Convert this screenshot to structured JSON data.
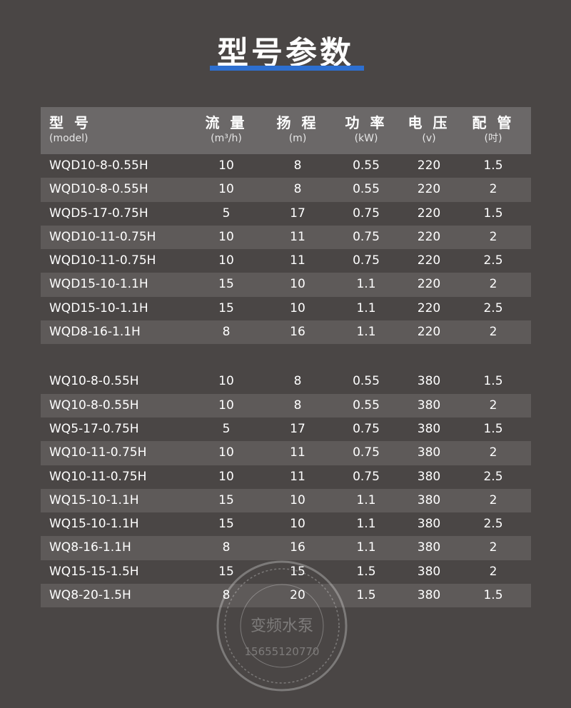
{
  "title": "型号参数",
  "headers": [
    {
      "zh": "型 号",
      "en": "(model)"
    },
    {
      "zh": "流 量",
      "en": "(m³/h)"
    },
    {
      "zh": "扬 程",
      "en": "(m)"
    },
    {
      "zh": "功 率",
      "en": "(kW)"
    },
    {
      "zh": "电 压",
      "en": "(v)"
    },
    {
      "zh": "配 管",
      "en": "(吋)"
    }
  ],
  "group1": [
    [
      "WQD10-8-0.55H",
      "10",
      "8",
      "0.55",
      "220",
      "1.5"
    ],
    [
      "WQD10-8-0.55H",
      "10",
      "8",
      "0.55",
      "220",
      "2"
    ],
    [
      "WQD5-17-0.75H",
      "5",
      "17",
      "0.75",
      "220",
      "1.5"
    ],
    [
      "WQD10-11-0.75H",
      "10",
      "11",
      "0.75",
      "220",
      "2"
    ],
    [
      "WQD10-11-0.75H",
      "10",
      "11",
      "0.75",
      "220",
      "2.5"
    ],
    [
      "WQD15-10-1.1H",
      "15",
      "10",
      "1.1",
      "220",
      "2"
    ],
    [
      "WQD15-10-1.1H",
      "15",
      "10",
      "1.1",
      "220",
      "2.5"
    ],
    [
      "WQD8-16-1.1H",
      "8",
      "16",
      "1.1",
      "220",
      "2"
    ]
  ],
  "group2": [
    [
      "WQ10-8-0.55H",
      "10",
      "8",
      "0.55",
      "380",
      "1.5"
    ],
    [
      "WQ10-8-0.55H",
      "10",
      "8",
      "0.55",
      "380",
      "2"
    ],
    [
      "WQ5-17-0.75H",
      "5",
      "17",
      "0.75",
      "380",
      "1.5"
    ],
    [
      "WQ10-11-0.75H",
      "10",
      "11",
      "0.75",
      "380",
      "2"
    ],
    [
      "WQ10-11-0.75H",
      "10",
      "11",
      "0.75",
      "380",
      "2.5"
    ],
    [
      "WQ15-10-1.1H",
      "15",
      "10",
      "1.1",
      "380",
      "2"
    ],
    [
      "WQ15-10-1.1H",
      "15",
      "10",
      "1.1",
      "380",
      "2.5"
    ],
    [
      "WQ8-16-1.1H",
      "8",
      "16",
      "1.1",
      "380",
      "2"
    ],
    [
      "WQ15-15-1.5H",
      "15",
      "15",
      "1.5",
      "380",
      "2"
    ],
    [
      "WQ8-20-1.5H",
      "8",
      "20",
      "1.5",
      "380",
      "1.5"
    ]
  ],
  "watermark": {
    "text": "变频水泵",
    "phone": "15655120770"
  },
  "colors": {
    "background": "#4a4645",
    "header": "#6b6868",
    "stripe": "#5e5a59",
    "accent": "#2d6fd0"
  }
}
